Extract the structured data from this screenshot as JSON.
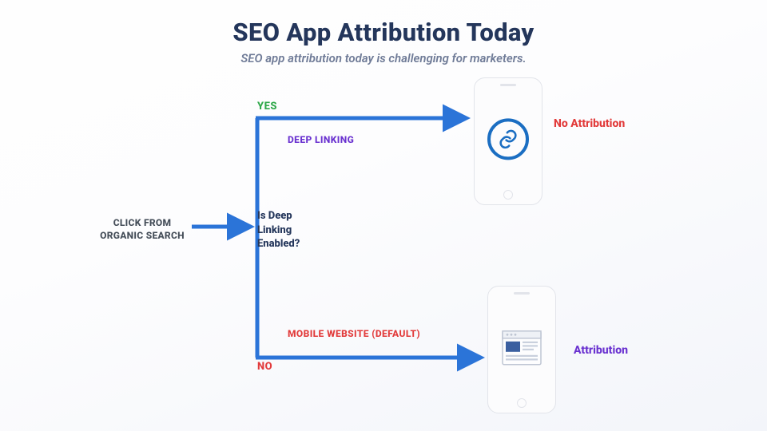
{
  "title": "SEO App Attribution Today",
  "subtitle": "SEO app attribution today is challenging for marketers.",
  "start_label": "CLICK FROM ORGANIC SEARCH",
  "decision_label": "Is Deep Linking Enabled?",
  "yes_label": "YES",
  "no_label": "NO",
  "path_yes_label": "DEEP LINKING",
  "path_no_label": "MOBILE WEBSITE (DEFAULT)",
  "result_yes": "No Attribution",
  "result_no": "Attribution",
  "colors": {
    "arrow": "#2b74d8",
    "title": "#24365b",
    "yes": "#2fa84a",
    "no": "#e23b3b",
    "purple": "#6a32d0"
  }
}
